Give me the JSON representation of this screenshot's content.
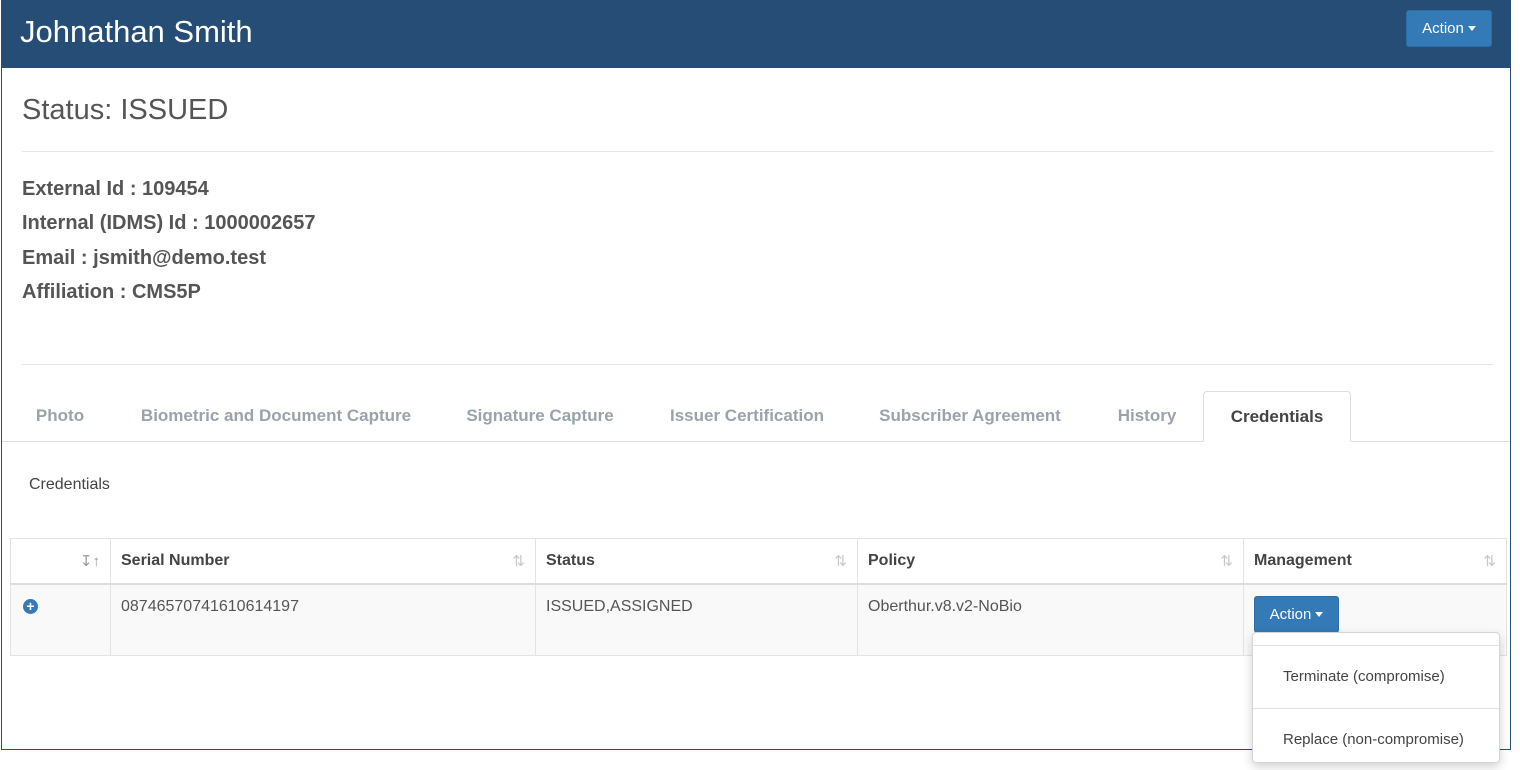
{
  "header": {
    "title": "Johnathan Smith",
    "action_label": "Action"
  },
  "status": {
    "title": "Status: ISSUED"
  },
  "info": {
    "external_id": "External Id : 109454",
    "internal_id": "Internal (IDMS) Id : 1000002657",
    "email": "Email : jsmith@demo.test",
    "affiliation": "Affiliation : CMS5P"
  },
  "tabs": [
    {
      "label": "Photo"
    },
    {
      "label": "Biometric and Document Capture"
    },
    {
      "label": "Signature Capture"
    },
    {
      "label": "Issuer Certification"
    },
    {
      "label": "Subscriber Agreement"
    },
    {
      "label": "History"
    },
    {
      "label": "Credentials",
      "active": true
    }
  ],
  "credentials": {
    "label": "Credentials",
    "columns": [
      "",
      "Serial Number",
      "Status",
      "Policy",
      "Management"
    ],
    "rows": [
      {
        "serial": "08746570741610614197",
        "status": "ISSUED,ASSIGNED",
        "policy": "Oberthur.v8.v2-NoBio",
        "action_label": "Action"
      }
    ]
  },
  "dropdown": {
    "items": [
      "Terminate (compromise)",
      "Replace (non-compromise)"
    ]
  },
  "colors": {
    "header_bg": "#254d75",
    "button_bg": "#337ab7"
  },
  "icons": {
    "sort": "sort-icon",
    "expand": "plus-circle-icon",
    "caret": "caret-down-icon"
  }
}
